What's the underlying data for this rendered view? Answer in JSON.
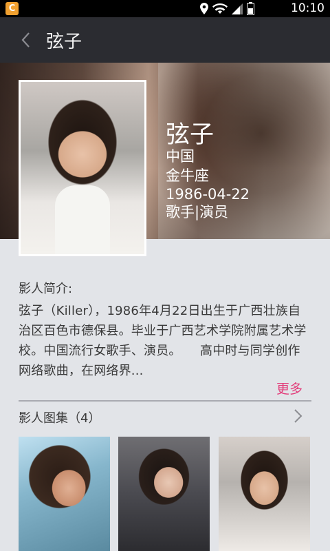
{
  "status_bar": {
    "app_icon_letter": "C",
    "time": "10:10",
    "battery_level": "4"
  },
  "action_bar": {
    "title": "弦子"
  },
  "profile": {
    "name": "弦子",
    "country": "中国",
    "zodiac": "金牛座",
    "birthday": "1986-04-22",
    "profession": "歌手|演员"
  },
  "intro": {
    "label": "影人简介:",
    "text": "弦子（Killer），1986年4月22日出生于广西壮族自治区百色市德保县。毕业于广西艺术学院附属艺术学校。中国流行女歌手、演员。　　高中时与同学创作网络歌曲，在网络界...",
    "more_label": "更多"
  },
  "gallery": {
    "label": "影人图集（4）",
    "photos": [
      "photo-1",
      "photo-2",
      "photo-3"
    ]
  },
  "colors": {
    "action_bar_bg": "#2b2c31",
    "page_bg": "#e2e4e8",
    "accent": "#e23d7a"
  }
}
